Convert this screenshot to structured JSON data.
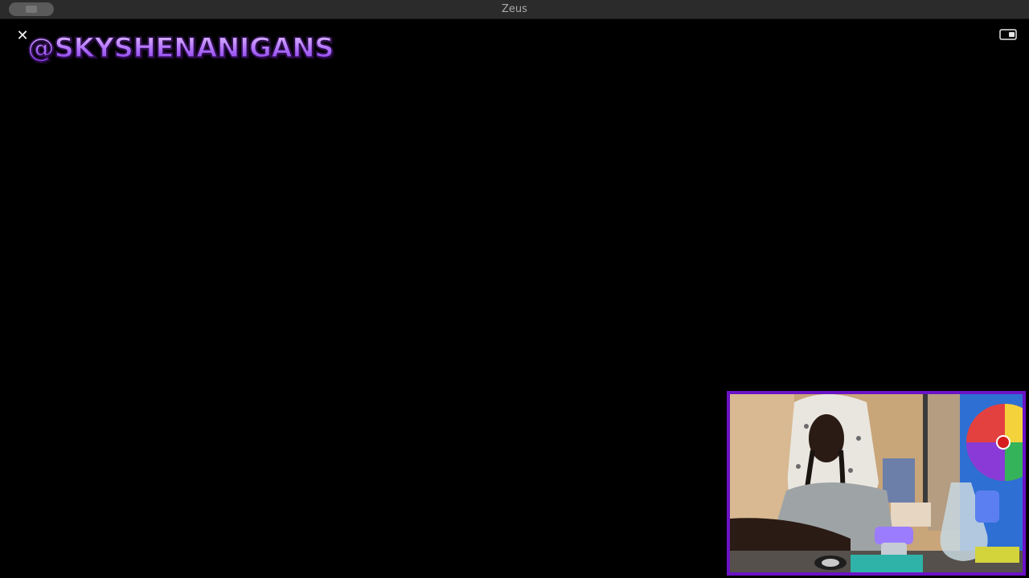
{
  "window": {
    "title": "Zeus"
  },
  "controls": {
    "close_glyph": "✕",
    "close_icon": "close-icon",
    "pip_icon": "picture-in-picture-icon"
  },
  "overlay": {
    "handle_text": "@SKYSHENANIGANS"
  },
  "webcam": {
    "border_color": "#6b12c7",
    "handle_color": "#b57cff"
  }
}
